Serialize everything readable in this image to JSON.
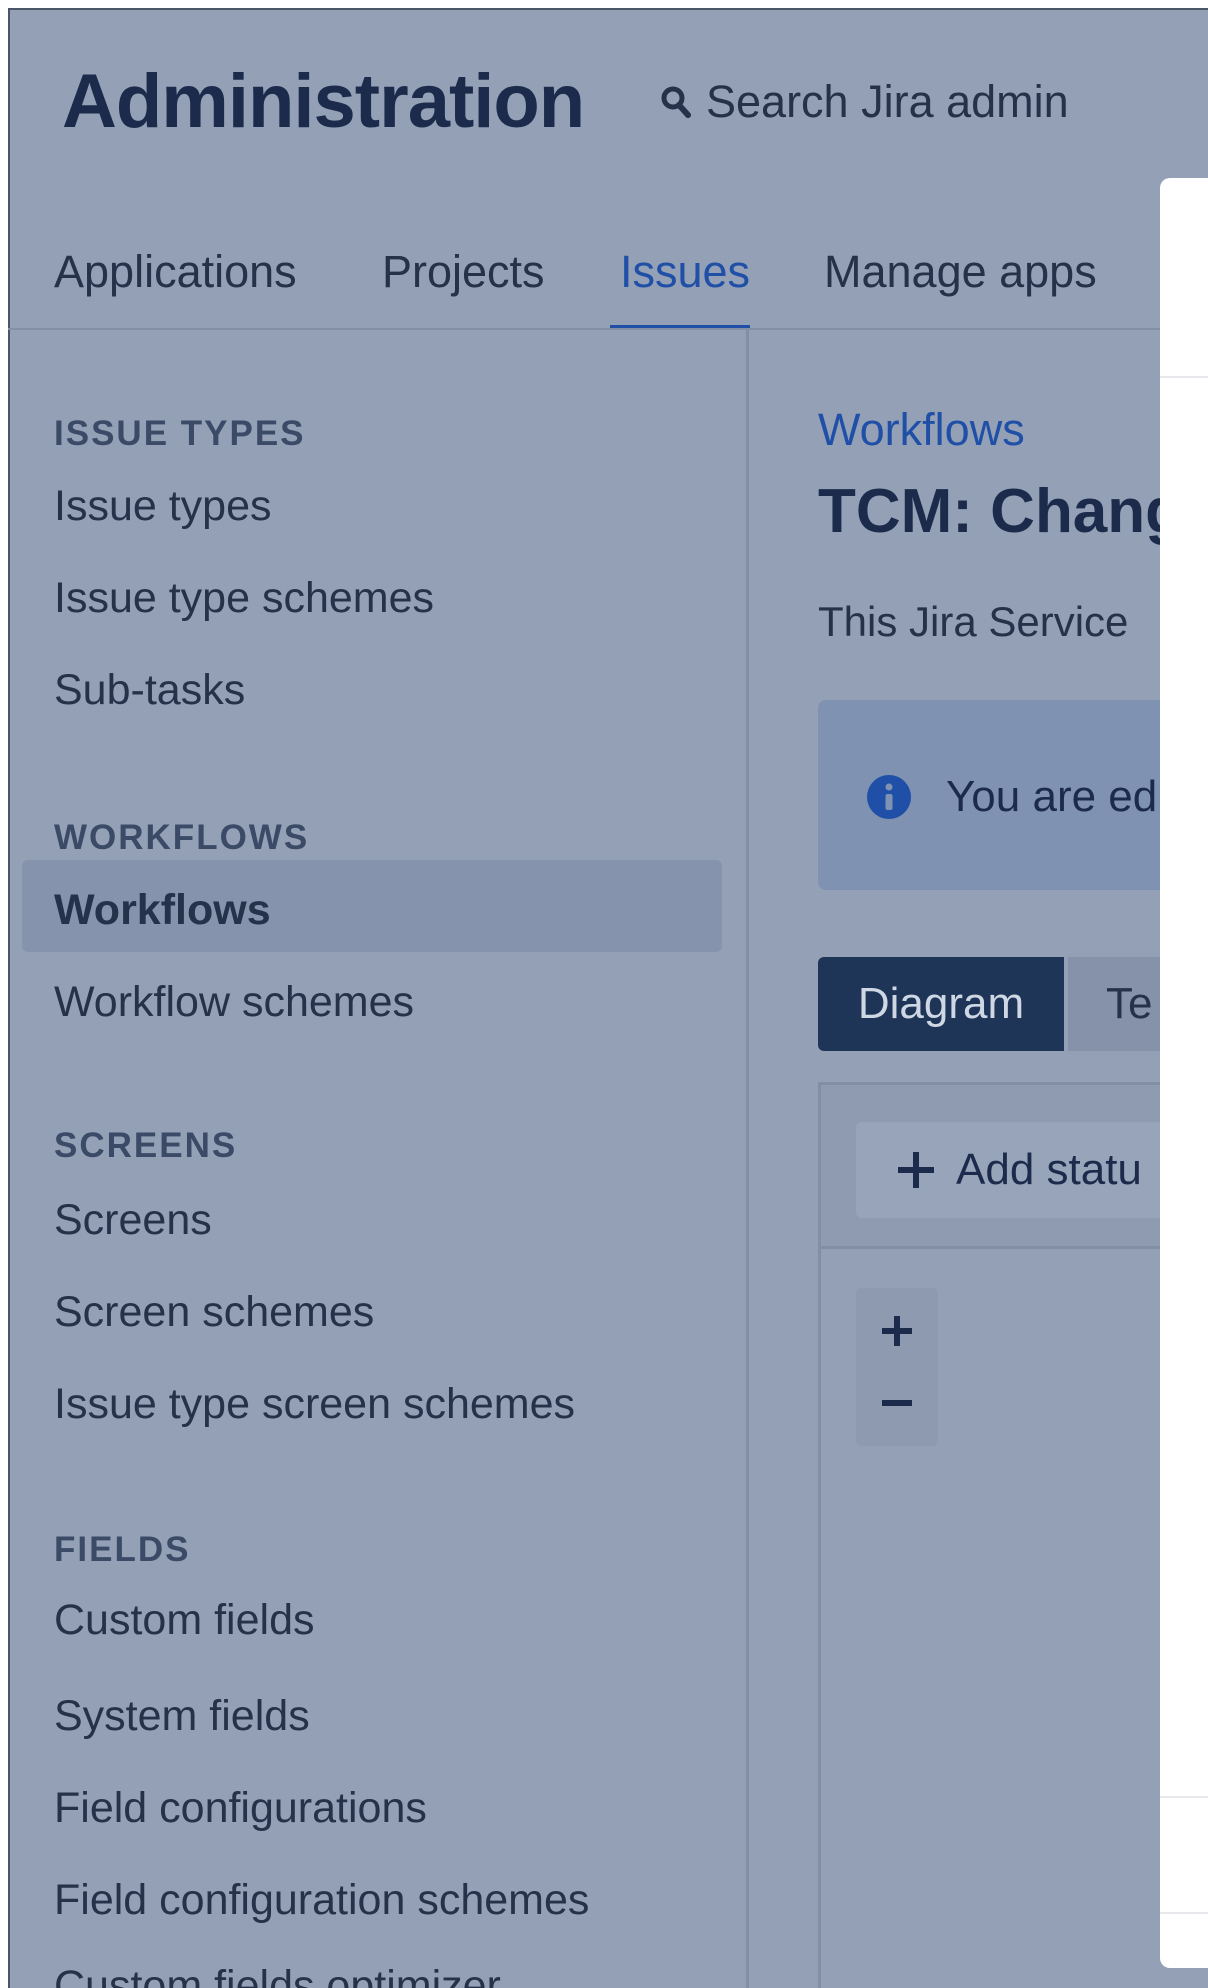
{
  "header": {
    "title": "Administration",
    "search_label": "Search Jira admin"
  },
  "top_tabs": [
    {
      "label": "Applications",
      "active": false
    },
    {
      "label": "Projects",
      "active": false
    },
    {
      "label": "Issues",
      "active": true
    },
    {
      "label": "Manage apps",
      "active": false
    }
  ],
  "sidebar": {
    "sections": [
      {
        "title": "ISSUE TYPES",
        "items": [
          "Issue types",
          "Issue type schemes",
          "Sub-tasks"
        ]
      },
      {
        "title": "WORKFLOWS",
        "items": [
          "Workflows",
          "Workflow schemes"
        ]
      },
      {
        "title": "SCREENS",
        "items": [
          "Screens",
          "Screen schemes",
          "Issue type screen schemes"
        ]
      },
      {
        "title": "FIELDS",
        "items": [
          "Custom fields",
          "System fields",
          "Field configurations",
          "Field configuration schemes",
          "Custom fields optimizer"
        ]
      }
    ],
    "selected": "Workflows"
  },
  "main": {
    "breadcrumb": "Workflows",
    "heading": "TCM: Chang",
    "description": "This Jira Service",
    "info_text": "You are ed",
    "view_toggle": {
      "diagram_label": "Diagram",
      "text_label": "Te"
    },
    "add_status_label": "Add statu",
    "zoom_in_label": "+",
    "zoom_out_label": "−"
  },
  "colors": {
    "accent": "#1f4fa6",
    "overlay_bg": "#93a0b5",
    "dark_button": "#1e3558"
  },
  "icons": {
    "search": "search-icon",
    "info": "info-icon",
    "add": "plus-icon",
    "zoom_in": "zoom-in-icon",
    "zoom_out": "zoom-out-icon"
  }
}
